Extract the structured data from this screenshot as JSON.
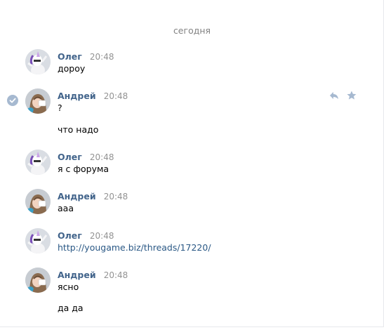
{
  "chat": {
    "day_divider": "сегодня",
    "messages": [
      {
        "author": "Олег",
        "time": "20:48",
        "lines": [
          "дороу"
        ],
        "avatar": "oleg-unicorn-avatar"
      },
      {
        "author": "Андрей",
        "time": "20:48",
        "lines": [
          "?",
          "что надо"
        ],
        "avatar": "andrey-photo-avatar",
        "selected": true,
        "actions": [
          "reply-icon",
          "star-icon"
        ]
      },
      {
        "author": "Олег",
        "time": "20:48",
        "lines": [
          "я с форума"
        ],
        "avatar": "oleg-unicorn-avatar"
      },
      {
        "author": "Андрей",
        "time": "20:48",
        "lines": [
          "ааа"
        ],
        "avatar": "andrey-photo-avatar"
      },
      {
        "author": "Олег",
        "time": "20:48",
        "lines": [
          "http://yougame.biz/threads/17220/"
        ],
        "avatar": "oleg-unicorn-avatar",
        "link": true
      },
      {
        "author": "Андрей",
        "time": "20:48",
        "lines": [
          "ясно",
          "да да"
        ],
        "avatar": "andrey-photo-avatar"
      }
    ]
  },
  "colors": {
    "author": "#42648b",
    "link": "#2a5885",
    "time": "#939393",
    "divider_text": "#828282",
    "check": "#a6b9d0",
    "action_icon": "#a6b9d0"
  }
}
